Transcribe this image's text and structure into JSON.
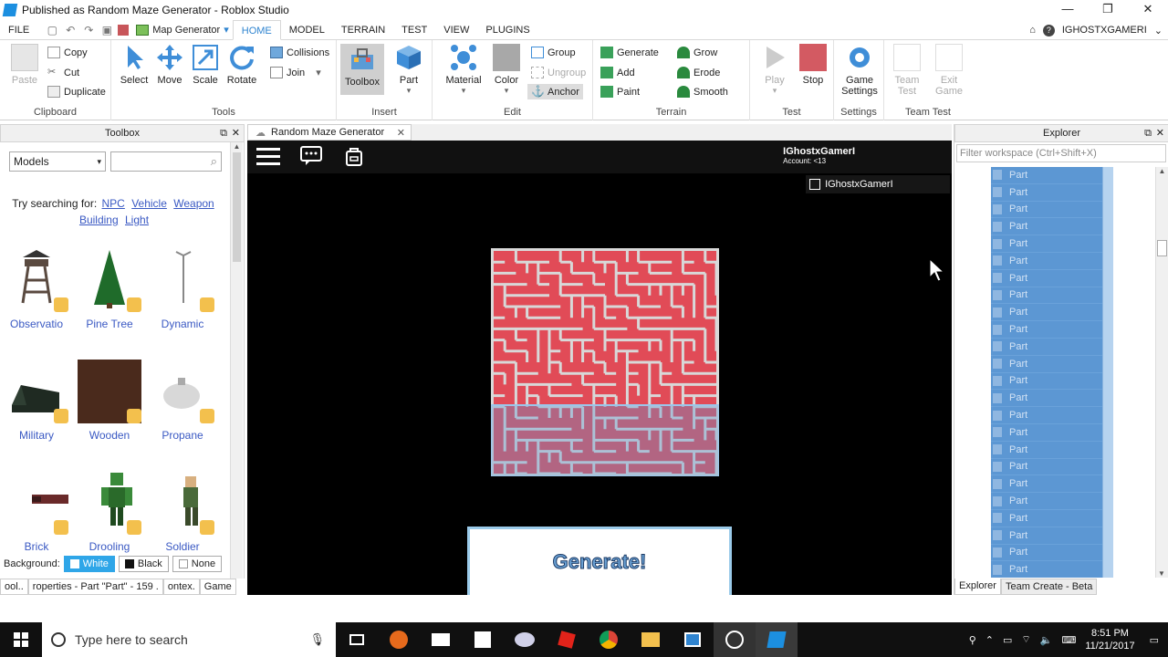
{
  "window": {
    "title": "Published as Random Maze Generator - Roblox Studio",
    "minimize": "—",
    "maximize": "❐",
    "close": "✕"
  },
  "menu": {
    "file": "FILE",
    "map_generator": "Map Generator",
    "tabs": [
      "HOME",
      "MODEL",
      "TERRAIN",
      "TEST",
      "VIEW",
      "PLUGINS"
    ],
    "active_tab": "HOME",
    "username": "IGHOSTXGAMERI"
  },
  "ribbon": {
    "clipboard": {
      "paste": "Paste",
      "copy": "Copy",
      "cut": "Cut",
      "duplicate": "Duplicate",
      "label": "Clipboard"
    },
    "tools": {
      "select": "Select",
      "move": "Move",
      "scale": "Scale",
      "rotate": "Rotate",
      "collisions": "Collisions",
      "join": "Join",
      "label": "Tools"
    },
    "insert": {
      "toolbox": "Toolbox",
      "part": "Part",
      "label": "Insert"
    },
    "edit": {
      "material": "Material",
      "color": "Color",
      "group": "Group",
      "ungroup": "Ungroup",
      "anchor": "Anchor",
      "label": "Edit"
    },
    "terrain": {
      "generate": "Generate",
      "grow": "Grow",
      "add": "Add",
      "erode": "Erode",
      "paint": "Paint",
      "smooth": "Smooth",
      "label": "Terrain"
    },
    "test": {
      "play": "Play",
      "stop": "Stop",
      "label": "Test"
    },
    "settings": {
      "game_settings": "Game Settings",
      "label": "Settings"
    },
    "team_test": {
      "team_test": "Team Test",
      "exit_game": "Exit Game",
      "label": "Team Test"
    }
  },
  "toolbox": {
    "header": "Toolbox",
    "category": "Models",
    "search_placeholder": "",
    "try_prefix": "Try searching for:",
    "suggestions": [
      "NPC",
      "Vehicle",
      "Weapon",
      "Building",
      "Light"
    ],
    "models": [
      {
        "name": "Observatio"
      },
      {
        "name": "Pine Tree"
      },
      {
        "name": "Dynamic"
      },
      {
        "name": "Military"
      },
      {
        "name": "Wooden"
      },
      {
        "name": "Propane"
      },
      {
        "name": "Brick"
      },
      {
        "name": "Drooling"
      },
      {
        "name": "Soldier"
      }
    ],
    "background_label": "Background:",
    "bg_white": "White",
    "bg_black": "Black",
    "bg_none": "None"
  },
  "bottom_tabs_left": [
    "ool..",
    "roperties - Part \"Part\" - 159 .",
    "ontex.",
    "Game"
  ],
  "viewport": {
    "tab_title": "Random Maze Generator",
    "account_name": "IGhostxGamerI",
    "account_sub": "Account: <13",
    "player_name": "IGhostxGamerI",
    "generate_label": "Generate!"
  },
  "explorer": {
    "header": "Explorer",
    "filter_placeholder": "Filter workspace (Ctrl+Shift+X)",
    "row_label": "Part",
    "tab_explorer": "Explorer",
    "tab_team_create": "Team Create - Beta"
  },
  "taskbar": {
    "search_placeholder": "Type here to search",
    "time": "8:51 PM",
    "date": "11/21/2017"
  },
  "colors": {
    "accent": "#2f84d0",
    "maze_red": "#e14b57",
    "selection_blue": "#5c97d3",
    "bg_selected": "#2fa6e8"
  }
}
